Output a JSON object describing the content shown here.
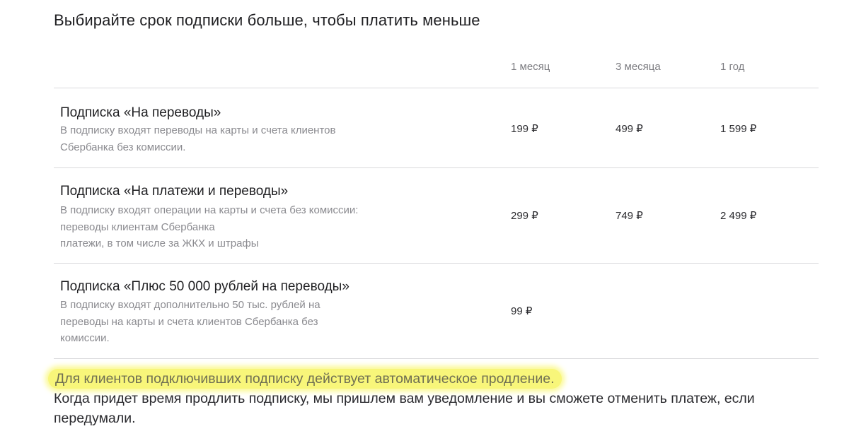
{
  "header": {
    "title": "Выбирайте срок подписки больше, чтобы платить меньше",
    "columns": [
      "1 месяц",
      "3 месяца",
      "1 год"
    ]
  },
  "plans": [
    {
      "title": "Подписка «На переводы»",
      "description": [
        "В подписку входят переводы на карты и счета клиентов",
        "Сбербанка без комиссии."
      ],
      "prices": [
        "199 ₽",
        "499 ₽",
        "1 599 ₽"
      ]
    },
    {
      "title": "Подписка «На платежи и переводы»",
      "description": [
        "В подписку входят операции на карты и счета без комиссии:",
        "переводы клиентам Сбербанка",
        "платежи, в том числе за ЖКХ и штрафы"
      ],
      "prices": [
        "299 ₽",
        "749 ₽",
        "2 499 ₽"
      ]
    },
    {
      "title": "Подписка «Плюс 50 000 рублей на переводы»",
      "description": [
        "В подписку входят дополнительно 50 тыс. рублей на",
        "переводы на карты и счета клиентов Сбербанка без",
        "комиссии."
      ],
      "prices": [
        "99 ₽"
      ]
    }
  ],
  "note": {
    "highlighted": "Для клиентов подключивших подписку действует автоматическое продление.",
    "text": "Когда придет время продлить подписку, мы пришлем вам уведомление и вы сможете отменить платеж, если передумали."
  },
  "colors": {
    "highlight": "#f8f67a",
    "divider": "#d9d9dc",
    "muted_text": "#8a8a8f"
  }
}
